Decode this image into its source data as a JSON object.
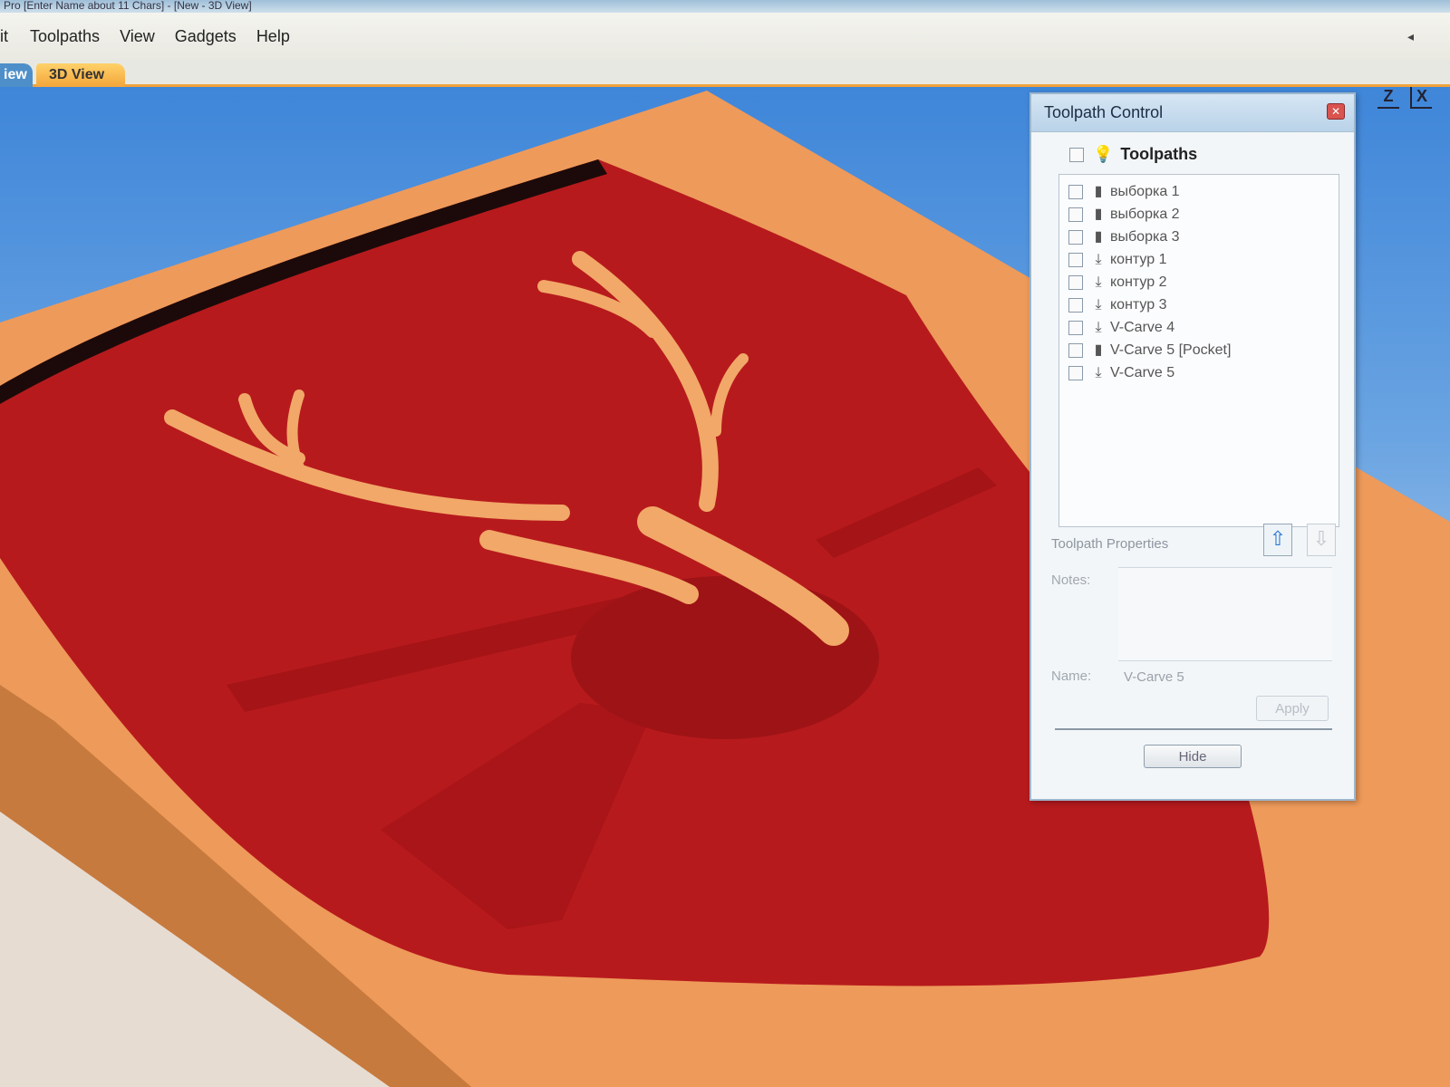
{
  "window": {
    "title": "Pro [Enter Name about 11 Chars] - [New - 3D View]"
  },
  "menu": {
    "items": [
      "it",
      "Toolpaths",
      "View",
      "Gadgets",
      "Help"
    ]
  },
  "tabs": [
    {
      "label": "iew"
    },
    {
      "label": "3D View"
    }
  ],
  "axes": {
    "z": "Z",
    "x": "X"
  },
  "toolpath_control": {
    "title": "Toolpath Control",
    "root_label": "Toolpaths",
    "items": [
      {
        "label": "выборка 1",
        "icon": "pocket-icon"
      },
      {
        "label": "выборка 2",
        "icon": "pocket-icon"
      },
      {
        "label": "выборка 3",
        "icon": "pocket-icon"
      },
      {
        "label": "контур 1",
        "icon": "profile-icon"
      },
      {
        "label": "контур 2",
        "icon": "profile-icon"
      },
      {
        "label": "контур 3",
        "icon": "profile-icon"
      },
      {
        "label": "V-Carve 4",
        "icon": "vcarve-icon"
      },
      {
        "label": "V-Carve 5 [Pocket]",
        "icon": "pocket-icon"
      },
      {
        "label": "V-Carve 5",
        "icon": "vcarve-icon"
      }
    ],
    "properties_label": "Toolpath Properties",
    "notes_label": "Notes:",
    "name_label": "Name:",
    "name_value": "V-Carve 5",
    "apply_label": "Apply",
    "hide_label": "Hide"
  },
  "colors": {
    "wood": "#f0a060",
    "plaque": "#b5171b",
    "accent": "#f3a53a"
  }
}
